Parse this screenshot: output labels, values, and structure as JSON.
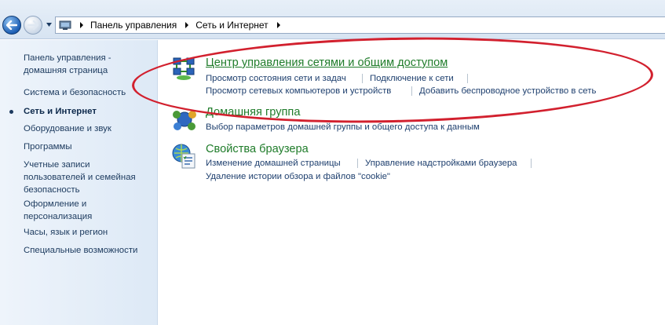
{
  "address_bar": {
    "breadcrumbs": [
      "Панель управления",
      "Сеть и Интернет"
    ]
  },
  "sidebar": {
    "home_link": "Панель управления -\nдомашняя страница",
    "items": [
      "Система и безопасность",
      "Сеть и Интернет",
      "Оборудование и звук",
      "Программы",
      "Учетные записи\nпользователей и семейная\nбезопасность",
      "Оформление и\nперсонализация",
      "Часы, язык и регион",
      "Специальные возможности"
    ],
    "active_item": "Сеть и Интернет"
  },
  "categories": [
    {
      "title": "Центр управления сетями и общим доступом",
      "icon": "network-center-icon",
      "links_row1": [
        "Просмотр состояния сети и задач",
        "Подключение к сети"
      ],
      "links_row2": [
        "Просмотр сетевых компьютеров и устройств",
        "Добавить беспроводное устройство в сеть"
      ]
    },
    {
      "title": "Домашняя группа",
      "icon": "homegroup-icon",
      "links_row1": [
        "Выбор параметров домашней группы и общего доступа к данным"
      ]
    },
    {
      "title": "Свойства браузера",
      "icon": "internet-options-icon",
      "links_row1": [
        "Изменение домашней страницы",
        "Управление надстройками браузера"
      ],
      "links_row2": [
        "Удаление истории обзора и файлов \"cookie\""
      ]
    }
  ],
  "colors": {
    "category_title": "#1f7c2a",
    "link": "#1e3f6e",
    "highlight": "#d2202e"
  }
}
